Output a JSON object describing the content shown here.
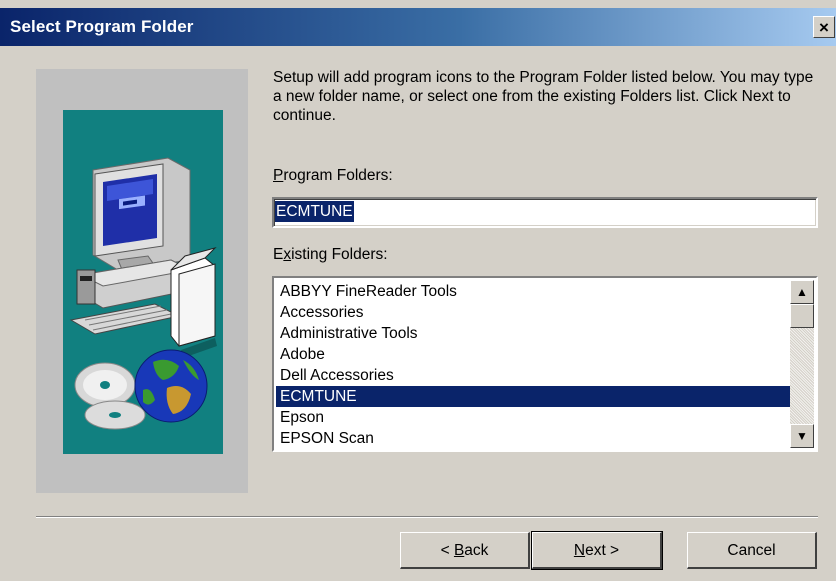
{
  "window": {
    "title": "Select Program Folder",
    "close_label": "×"
  },
  "intro": {
    "text": "Setup will add program icons to the Program Folder listed below.  You may type a new folder name, or select one from the existing Folders list.  Click Next to continue."
  },
  "program_folders": {
    "label_accel": "P",
    "label_rest": "rogram Folders:",
    "value": "ECMTUNE"
  },
  "existing_folders": {
    "label_pre": "E",
    "label_accel": "x",
    "label_rest": "isting Folders:",
    "items": [
      "ABBYY FineReader Tools",
      "Accessories",
      "Administrative Tools",
      "Adobe",
      "Dell Accessories",
      "ECMTUNE",
      "Epson",
      "EPSON Scan"
    ],
    "selected": "ECMTUNE"
  },
  "scrollbar": {
    "up_icon": "up-arrow-icon",
    "down_icon": "down-arrow-icon"
  },
  "buttons": {
    "back_prefix": "< ",
    "back_accel": "B",
    "back_rest": "ack",
    "next_accel": "N",
    "next_rest": "ext >",
    "cancel": "Cancel"
  },
  "colors": {
    "title_start": "#0a246a",
    "title_end": "#a6caf0",
    "dialog_bg": "#d4d0c8",
    "illustration_bg": "#118080",
    "selection": "#0a246a"
  },
  "illustration": {
    "description_icon": "computer-setup-illustration-icon"
  }
}
